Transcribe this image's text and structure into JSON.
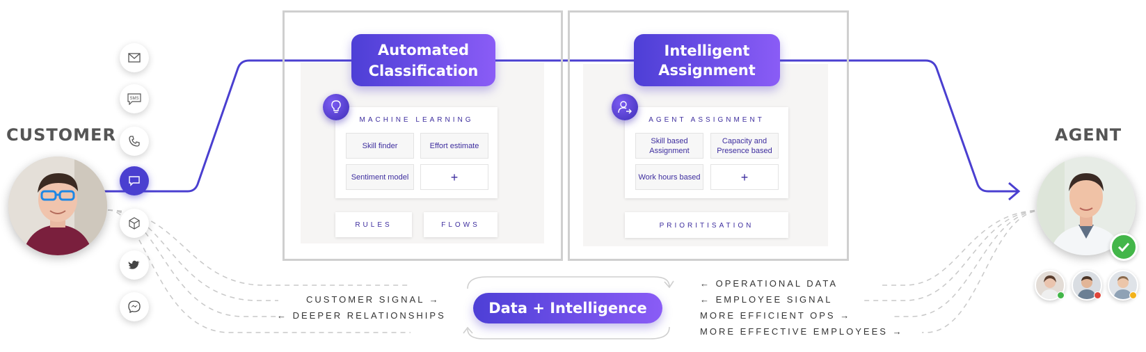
{
  "customer": {
    "heading": "CUSTOMER"
  },
  "agent": {
    "heading": "AGENT"
  },
  "channels": [
    {
      "icon": "mail-icon"
    },
    {
      "icon": "sms-icon",
      "label": "SMS"
    },
    {
      "icon": "phone-icon"
    },
    {
      "icon": "chat-icon",
      "active": true
    },
    {
      "icon": "package-icon"
    },
    {
      "icon": "twitter-icon"
    },
    {
      "icon": "messenger-icon"
    }
  ],
  "classification": {
    "title": "Automated Classification",
    "title_line1": "Automated",
    "title_line2": "Classification",
    "section_label": "MACHINE LEARNING",
    "items": [
      "Skill finder",
      "Effort estimate",
      "Sentiment model",
      "+"
    ],
    "rules_label": "RULES",
    "flows_label": "FLOWS",
    "badge_icon": "lightbulb-icon"
  },
  "assignment": {
    "title": "Intelligent Assignment",
    "title_line1": "Intelligent",
    "title_line2": "Assignment",
    "section_label": "AGENT ASSIGNMENT",
    "items": [
      "Skill  based Assignment",
      "Capacity and Presence based",
      "Work hours based",
      "+"
    ],
    "prioritisation_label": "PRIORITISATION",
    "badge_icon": "person-arrow-icon"
  },
  "data_intelligence": {
    "label": "Data + Intelligence"
  },
  "left_signals": [
    {
      "text": "CUSTOMER SIGNAL",
      "arrow": "→",
      "direction": "right"
    },
    {
      "text": "DEEPER RELATIONSHIPS",
      "arrow": "←",
      "direction": "left"
    }
  ],
  "right_signals": [
    {
      "text": "OPERATIONAL DATA",
      "arrow": "←",
      "direction": "left"
    },
    {
      "text": "EMPLOYEE SIGNAL",
      "arrow": "←",
      "direction": "left"
    },
    {
      "text": "MORE EFFICIENT OPS",
      "arrow": "→",
      "direction": "right"
    },
    {
      "text": "MORE EFFECTIVE EMPLOYEES",
      "arrow": "→",
      "direction": "right"
    }
  ],
  "status_colors": {
    "available": "#43b649",
    "busy": "#e0453a",
    "away": "#f2b21b"
  },
  "accent_color": "#4a3fd0"
}
